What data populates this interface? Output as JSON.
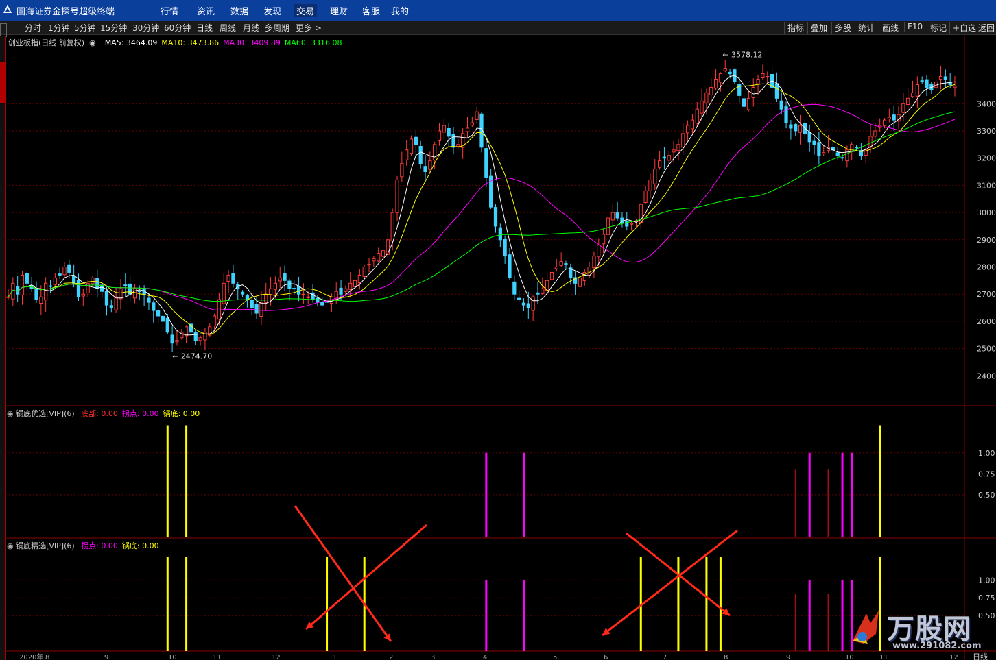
{
  "app": {
    "title": "国海证券金探号超级终端"
  },
  "main_nav": [
    "行情",
    "资讯",
    "数据",
    "发现",
    "交易",
    "理财",
    "客服",
    "我的"
  ],
  "main_nav_active": "交易",
  "periods": [
    "分时",
    "1分钟",
    "5分钟",
    "15分钟",
    "30分钟",
    "60分钟",
    "日线",
    "周线",
    "月线",
    "多周期",
    "更多 >"
  ],
  "active_period": "日线",
  "right_tools": [
    "指标",
    "叠加",
    "多股",
    "统计",
    "画线",
    "F10",
    "标记",
    "+自选",
    "返回"
  ],
  "chart_header": {
    "name": "创业板指(日线 前复权)",
    "ma": [
      {
        "label": "MA5: ",
        "value": "3464.09",
        "color": "#ffffff"
      },
      {
        "label": "MA10: ",
        "value": "3473.86",
        "color": "#ffff00"
      },
      {
        "label": "MA30: ",
        "value": "3409.89",
        "color": "#ff00ff"
      },
      {
        "label": "MA60: ",
        "value": "3316.08",
        "color": "#00ff00"
      }
    ]
  },
  "annotations": {
    "high": "3578.12",
    "low": "2474.70"
  },
  "panel1": {
    "name": "锅底优选[VIP](6)",
    "items": [
      {
        "label": "底部: ",
        "value": "0.00",
        "color": "#ff3030"
      },
      {
        "label": "拐点: ",
        "value": "0.00",
        "color": "#ff00ff"
      },
      {
        "label": "锅底: ",
        "value": "0.00",
        "color": "#ffff00"
      }
    ]
  },
  "panel2": {
    "name": "锅底精选[VIP](6)",
    "items": [
      {
        "label": "拐点: ",
        "value": "0.00",
        "color": "#ff00ff"
      },
      {
        "label": "锅底: ",
        "value": "0.00",
        "color": "#ffff00"
      }
    ]
  },
  "x_axis": {
    "labels": [
      "2020年",
      "8",
      "9",
      "10",
      "11",
      "12",
      "1",
      "2",
      "3",
      "4",
      "5",
      "6",
      "7",
      "8",
      "9",
      "10",
      "11",
      "12"
    ],
    "period_label": "日线"
  },
  "watermark": {
    "text": "万股网",
    "url": "www.291082.com"
  },
  "colors": {
    "up": "#ff3b3b",
    "down": "#3fd3ff",
    "ma5": "#ffffff",
    "ma10": "#ffff00",
    "ma30": "#ff00ff",
    "ma60": "#00ff00",
    "grid": "#6a0000",
    "cross": "#ff2a1a"
  },
  "chart_data": [
    {
      "type": "candlestick",
      "title": "创业板指(日线 前复权)",
      "y_ticks": [
        2400,
        2500,
        2600,
        2700,
        2800,
        2900,
        3000,
        3100,
        3200,
        3300,
        3400
      ],
      "ylim": [
        2290,
        3650
      ],
      "legend": [
        "MA5",
        "MA10",
        "MA30",
        "MA60"
      ],
      "close": [
        2690,
        2740,
        2700,
        2770,
        2740,
        2720,
        2680,
        2690,
        2740,
        2730,
        2760,
        2770,
        2800,
        2780,
        2740,
        2690,
        2700,
        2740,
        2760,
        2720,
        2710,
        2660,
        2650,
        2690,
        2720,
        2730,
        2700,
        2720,
        2710,
        2700,
        2670,
        2640,
        2620,
        2600,
        2560,
        2520,
        2530,
        2560,
        2580,
        2560,
        2530,
        2540,
        2560,
        2580,
        2620,
        2680,
        2740,
        2770,
        2740,
        2720,
        2700,
        2680,
        2650,
        2630,
        2670,
        2700,
        2720,
        2740,
        2760,
        2750,
        2720,
        2720,
        2700,
        2700,
        2690,
        2680,
        2670,
        2660,
        2670,
        2690,
        2710,
        2700,
        2720,
        2740,
        2750,
        2770,
        2800,
        2810,
        2830,
        2850,
        2860,
        2900,
        3000,
        3120,
        3180,
        3230,
        3270,
        3250,
        3180,
        3150,
        3190,
        3250,
        3300,
        3320,
        3280,
        3240,
        3250,
        3290,
        3310,
        3330,
        3370,
        3240,
        3130,
        3020,
        2950,
        2900,
        2840,
        2760,
        2700,
        2680,
        2660,
        2650,
        2690,
        2700,
        2720,
        2750,
        2780,
        2800,
        2820,
        2810,
        2760,
        2740,
        2760,
        2780,
        2800,
        2840,
        2880,
        2920,
        2980,
        3000,
        2980,
        2960,
        2950,
        2960,
        2970,
        3030,
        3080,
        3120,
        3160,
        3190,
        3200,
        3210,
        3230,
        3250,
        3290,
        3320,
        3340,
        3380,
        3410,
        3440,
        3460,
        3490,
        3510,
        3530,
        3510,
        3480,
        3430,
        3390,
        3420,
        3460,
        3490,
        3510,
        3500,
        3460,
        3420,
        3380,
        3330,
        3310,
        3300,
        3320,
        3290,
        3260,
        3250,
        3210,
        3220,
        3240,
        3230,
        3210,
        3200,
        3230,
        3250,
        3240,
        3210,
        3230,
        3280,
        3300,
        3320,
        3340,
        3350,
        3340,
        3360,
        3400,
        3420,
        3440,
        3470,
        3480,
        3460,
        3450,
        3480,
        3500,
        3490,
        3470,
        3464
      ]
    },
    {
      "type": "bar",
      "title": "锅底优选[VIP](6)",
      "y_ticks": [
        0.5,
        0.75,
        1.0
      ],
      "series": [
        {
          "name": "锅底",
          "color": "#ffff00",
          "points": [
            [
              34,
              1.33
            ],
            [
              38,
              1.33
            ],
            [
              186,
              1.33
            ]
          ]
        },
        {
          "name": "拐点",
          "color": "#ff00ff",
          "points": [
            [
              102,
              1.0
            ],
            [
              110,
              1.0
            ],
            [
              171,
              1.0
            ],
            [
              178,
              1.0
            ],
            [
              180,
              1.0
            ]
          ]
        },
        {
          "name": "底部",
          "color": "#a01010",
          "points": [
            [
              168,
              0.8
            ],
            [
              175,
              0.8
            ]
          ]
        }
      ]
    },
    {
      "type": "bar",
      "title": "锅底精选[VIP](6)",
      "y_ticks": [
        0.5,
        0.75,
        1.0
      ],
      "series": [
        {
          "name": "锅底",
          "color": "#ffff00",
          "points": [
            [
              34,
              1.33
            ],
            [
              38,
              1.33
            ],
            [
              68,
              1.33
            ],
            [
              76,
              1.33
            ],
            [
              135,
              1.33
            ],
            [
              143,
              1.33
            ],
            [
              149,
              1.33
            ],
            [
              152,
              1.33
            ],
            [
              186,
              1.33
            ]
          ]
        },
        {
          "name": "拐点",
          "color": "#ff00ff",
          "points": [
            [
              102,
              1.0
            ],
            [
              110,
              1.0
            ],
            [
              171,
              1.0
            ],
            [
              178,
              1.0
            ],
            [
              180,
              1.0
            ]
          ]
        },
        {
          "name": "底部",
          "color": "#a01010",
          "points": [
            [
              168,
              0.8
            ],
            [
              175,
              0.8
            ]
          ]
        }
      ]
    }
  ]
}
